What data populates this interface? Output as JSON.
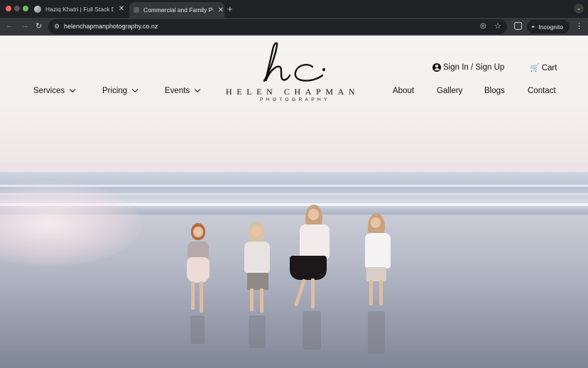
{
  "browser": {
    "tabs": [
      {
        "title": "Haziq Khatri | Full Stack Developer",
        "active": false
      },
      {
        "title": "Commercial and Family Photography",
        "active": true
      }
    ],
    "new_tab_label": "+",
    "url": "helenchapmanphotography.co.nz",
    "incognito_label": "Incognito",
    "icons": {
      "back": "arrow-left-icon",
      "forward": "arrow-right-icon",
      "reload": "reload-icon",
      "site_info": "tune-icon",
      "eye": "eye-off-icon",
      "star": "star-icon",
      "extension": "extension-icon",
      "incognito": "incognito-icon",
      "menu": "kebab-menu-icon"
    }
  },
  "site": {
    "logo_mark": "hc",
    "logo_name": "HELEN CHAPMAN",
    "logo_sub": "PHOTOGRAPHY",
    "nav_left": [
      {
        "label": "Services",
        "dropdown": true
      },
      {
        "label": "Pricing",
        "dropdown": true
      },
      {
        "label": "Events",
        "dropdown": true
      }
    ],
    "nav_right": [
      {
        "label": "About"
      },
      {
        "label": "Gallery"
      },
      {
        "label": "Blogs"
      },
      {
        "label": "Contact"
      }
    ],
    "account_label": "Sign In / Sign Up",
    "cart_label": "Cart",
    "colors": {
      "text": "#111111",
      "sky": "#f4f1f0",
      "sea": "#b9c2d3"
    }
  }
}
